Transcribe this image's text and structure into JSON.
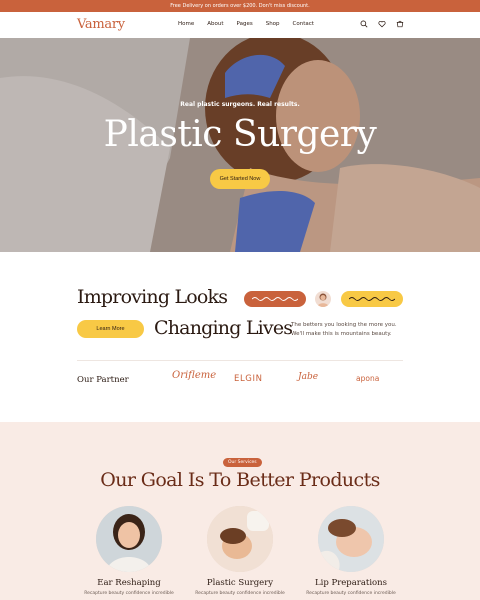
{
  "announcement": "Free Delivery on orders over $200. Don't miss discount.",
  "header": {
    "logo": "Vamary",
    "nav": [
      "Home",
      "About",
      "Pages",
      "Shop",
      "Contact"
    ],
    "icons": [
      "search-icon",
      "heart-icon",
      "cart-icon"
    ]
  },
  "hero": {
    "eyebrow": "Real plastic surgeons. Real results.",
    "title": "Plastic Surgery",
    "cta": "Get Started Now"
  },
  "improve": {
    "line1": "Improving Looks",
    "line2": "Changing Lives",
    "button": "Learn More",
    "tagline": "The betters you looking the more you. We'll make this is mountains beauty."
  },
  "partners": {
    "label": "Our Partner",
    "logos": [
      "Orifleme",
      "ELGIN",
      "Jabe",
      "apona"
    ]
  },
  "services": {
    "badge": "Our Services",
    "title": "Our Goal Is To Better Products",
    "cards": [
      {
        "name": "Ear Reshaping",
        "desc": "Recapture beauty confidence incredible"
      },
      {
        "name": "Plastic Surgery",
        "desc": "Recapture beauty confidence incredible"
      },
      {
        "name": "Lip Preparations",
        "desc": "Recapture beauty confidence incredible"
      }
    ]
  },
  "colors": {
    "accent": "#c9623c",
    "yellow": "#f8c945",
    "services_bg": "#f9ebe5"
  }
}
